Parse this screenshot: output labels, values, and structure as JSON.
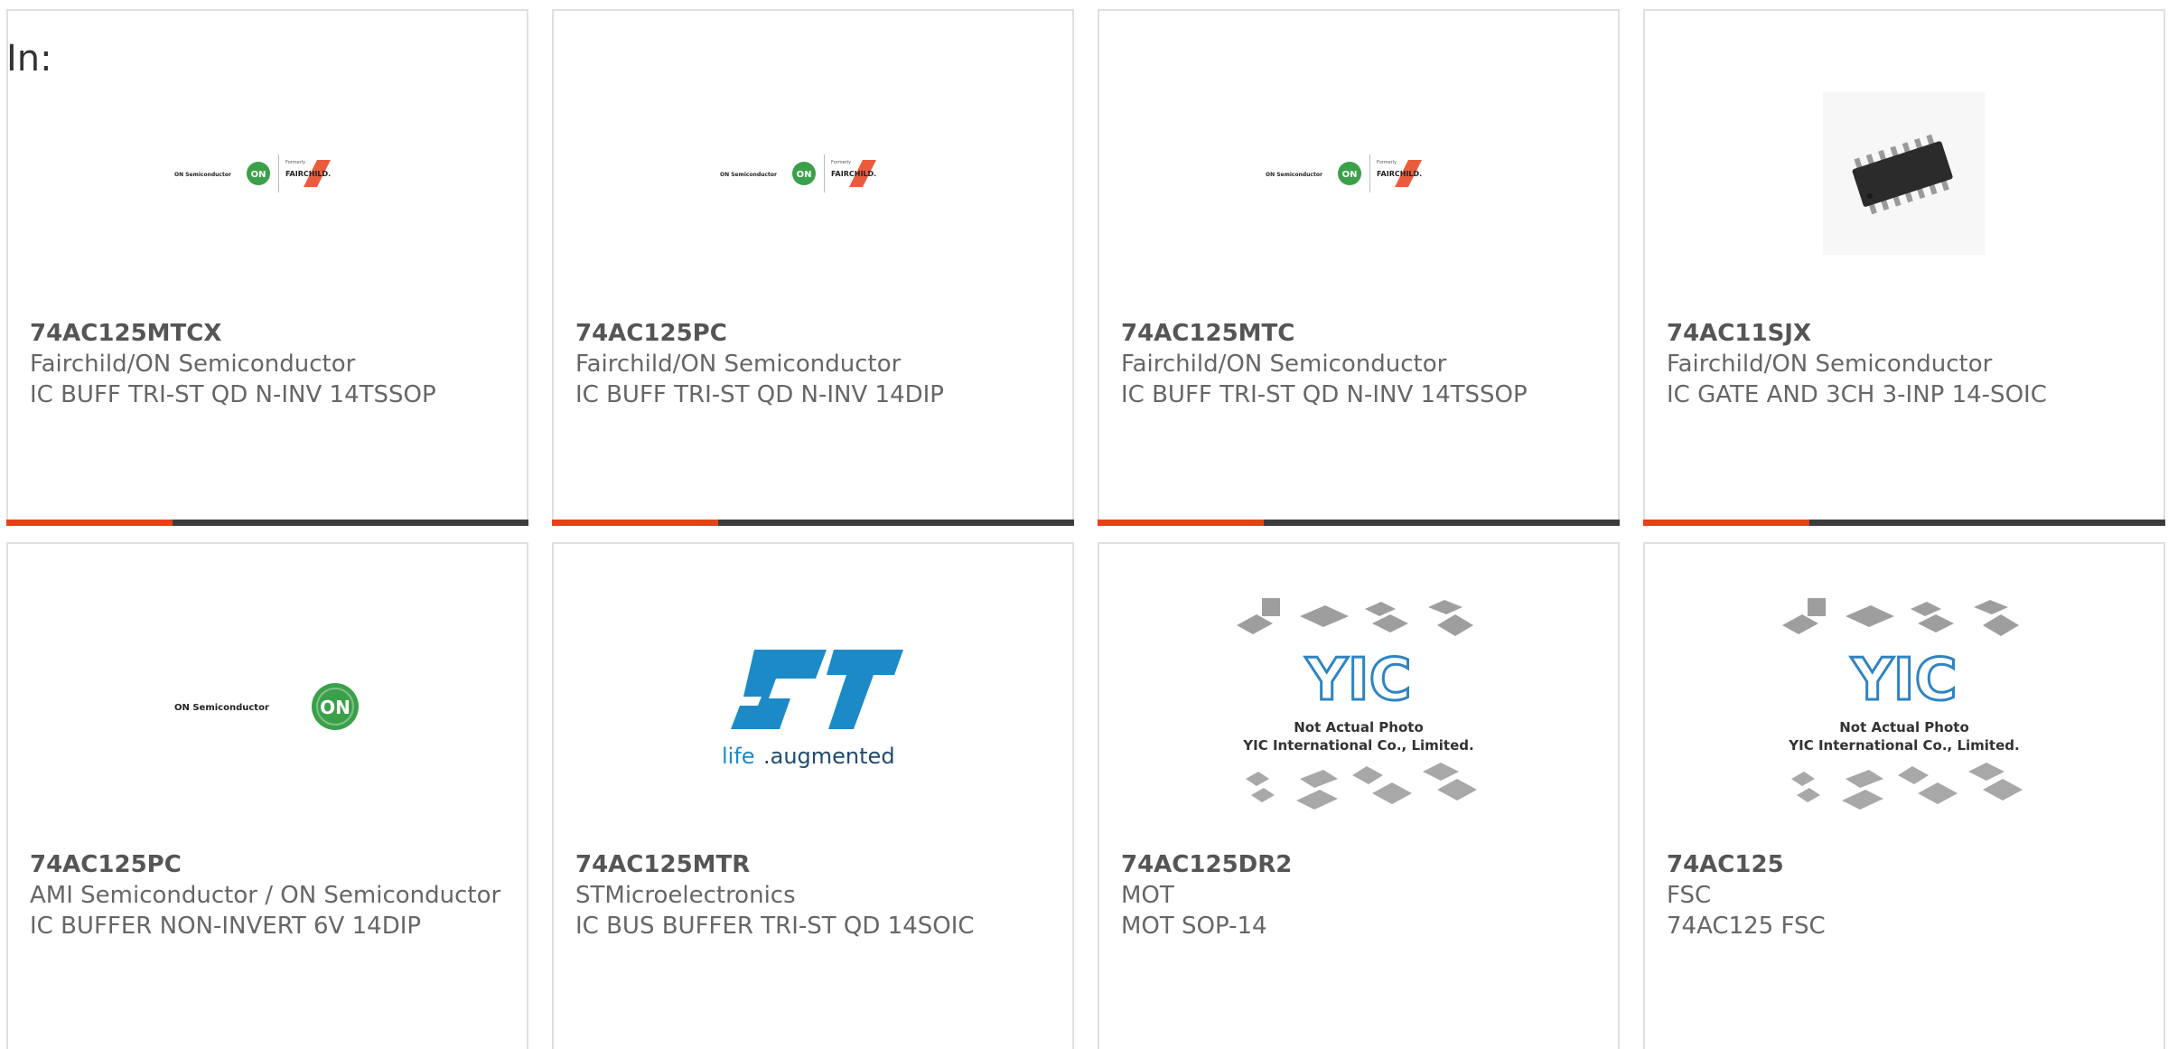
{
  "filter_label": "In:",
  "cards": [
    {
      "part": "74AC125MTCX",
      "maker": "Fairchild/ON Semiconductor",
      "desc": "IC BUFF TRI-ST QD N-INV 14TSSOP",
      "image": "on-fairchild-logo"
    },
    {
      "part": "74AC125PC",
      "maker": "Fairchild/ON Semiconductor",
      "desc": "IC BUFF TRI-ST QD N-INV 14DIP",
      "image": "on-fairchild-logo"
    },
    {
      "part": "74AC125MTC",
      "maker": "Fairchild/ON Semiconductor",
      "desc": "IC BUFF TRI-ST QD N-INV 14TSSOP",
      "image": "on-fairchild-logo"
    },
    {
      "part": "74AC11SJX",
      "maker": "Fairchild/ON Semiconductor",
      "desc": "IC GATE AND 3CH 3-INP 14-SOIC",
      "image": "soic-chip-photo"
    },
    {
      "part": "74AC125PC",
      "maker": "AMI Semiconductor / ON Semiconductor",
      "desc": "IC BUFFER NON-INVERT 6V 14DIP",
      "image": "on-semiconductor-logo"
    },
    {
      "part": "74AC125MTR",
      "maker": "STMicroelectronics",
      "desc": "IC BUS BUFFER TRI-ST QD 14SOIC",
      "image": "st-logo"
    },
    {
      "part": "74AC125DR2",
      "maker": "MOT",
      "desc": "MOT SOP-14",
      "image": "yic-placeholder"
    },
    {
      "part": "74AC125",
      "maker": "FSC",
      "desc": "74AC125 FSC",
      "image": "yic-placeholder"
    }
  ],
  "logos": {
    "on_semiconductor": "ON Semiconductor",
    "on_badge": "ON",
    "formerly": "Formerly",
    "fairchild": "FAIRCHILD.",
    "st_life": "life",
    "st_augmented": ".augmented",
    "yic_mark": "YIC",
    "yic_line1": "Not Actual Photo",
    "yic_line2": "YIC International Co., Limited."
  },
  "colors": {
    "accent": "#e8401a",
    "bar_dark": "#3c3c3c",
    "on_green": "#3aa04a",
    "st_blue": "#1b8ac7"
  }
}
